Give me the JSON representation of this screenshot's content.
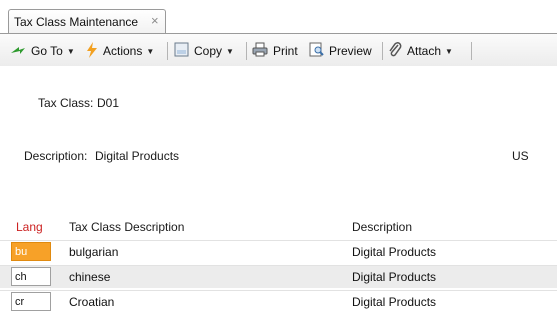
{
  "tab": {
    "title": "Tax Class Maintenance",
    "close": "×"
  },
  "toolbar": {
    "goto": "Go To",
    "actions": "Actions",
    "copy": "Copy",
    "print": "Print",
    "preview": "Preview",
    "attach": "Attach"
  },
  "form": {
    "tax_class_label": "Tax Class:",
    "tax_class_value": "D01",
    "description_label": "Description:",
    "description_value": "Digital Products",
    "country": "US"
  },
  "grid": {
    "headers": {
      "lang": "Lang",
      "tax_class_desc": "Tax Class Description",
      "description": "Description"
    },
    "rows": [
      {
        "lang": "bu",
        "tax_class_desc": "bulgarian",
        "description": "Digital Products"
      },
      {
        "lang": "ch",
        "tax_class_desc": "chinese",
        "description": "Digital Products"
      },
      {
        "lang": "cr",
        "tax_class_desc": "Croatian",
        "description": "Digital Products"
      }
    ]
  },
  "colors": {
    "selected_cell": "#f7a128",
    "lang_header": "#cc2222"
  }
}
